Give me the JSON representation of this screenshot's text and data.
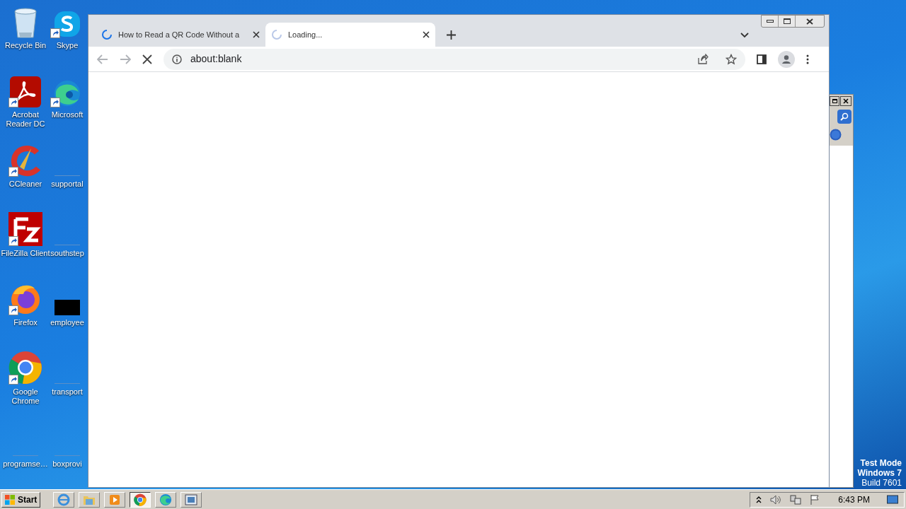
{
  "desktop_icons": [
    {
      "label": "Recycle Bin",
      "kind": "recycle",
      "shortcut": false
    },
    {
      "label": "Skype",
      "kind": "skype",
      "shortcut": true
    },
    {
      "label": "Acrobat Reader DC",
      "kind": "acrobat",
      "shortcut": true
    },
    {
      "label": "Microsoft",
      "kind": "edge",
      "shortcut": true
    },
    {
      "label": "CCleaner",
      "kind": "ccleaner",
      "shortcut": true
    },
    {
      "label": "supportal",
      "kind": "blank",
      "shortcut": false
    },
    {
      "label": "FileZilla Client",
      "kind": "filezilla",
      "shortcut": true
    },
    {
      "label": "southstep",
      "kind": "blank",
      "shortcut": false
    },
    {
      "label": "Firefox",
      "kind": "firefox",
      "shortcut": true
    },
    {
      "label": "employee",
      "kind": "black",
      "shortcut": false
    },
    {
      "label": "Google Chrome",
      "kind": "chrome",
      "shortcut": true
    },
    {
      "label": "transport",
      "kind": "blank",
      "shortcut": false
    },
    {
      "label": "programse…",
      "kind": "blank",
      "shortcut": false
    },
    {
      "label": "boxprovi",
      "kind": "blank",
      "shortcut": false
    }
  ],
  "browser": {
    "tabs": [
      {
        "title": "How to Read a QR Code Without a",
        "selected": false
      },
      {
        "title": "Loading...",
        "selected": true
      }
    ],
    "address": "about:blank"
  },
  "taskbar": {
    "start": "Start",
    "apps": [
      {
        "kind": "ie",
        "selected": false
      },
      {
        "kind": "folder",
        "selected": false
      },
      {
        "kind": "media",
        "selected": false
      },
      {
        "kind": "chrome",
        "selected": true
      },
      {
        "kind": "edge",
        "selected": false
      },
      {
        "kind": "screen",
        "selected": false
      }
    ],
    "time": "6:43 PM"
  },
  "watermark": [
    "Test Mode",
    "Windows 7",
    "Build 7601"
  ]
}
